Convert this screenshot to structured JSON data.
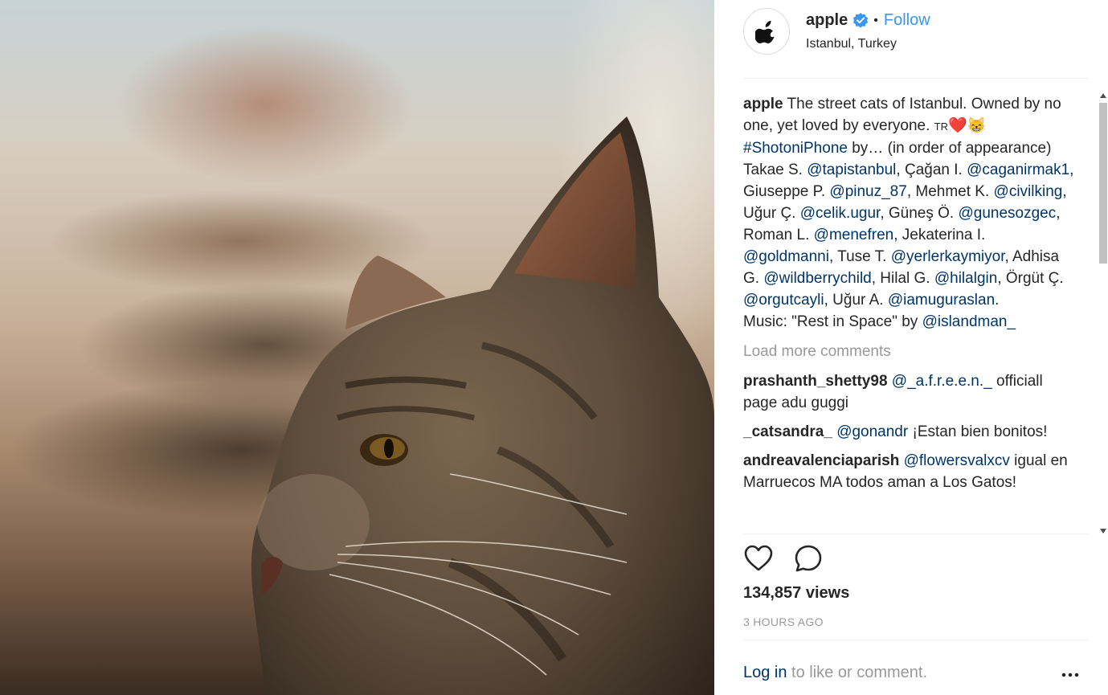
{
  "post": {
    "username": "apple",
    "separator": "•",
    "follow_label": "Follow",
    "location": "Istanbul, Turkey"
  },
  "caption": {
    "username": "apple",
    "t1": " The street cats of Istanbul. Owned by no one, yet loved by everyone. ",
    "flag": "TR",
    "emoji": "❤️😸",
    "hashtag": "#ShotoniPhone",
    "t2": " by… (in order of appearance) Takae S. ",
    "m1": "@tapistanbul",
    "t3": ", Çağan I. ",
    "m2": "@caganirmak1",
    "t4": ", Giuseppe P. ",
    "m3": "@pinuz_87",
    "t5": ", Mehmet K. ",
    "m4": "@civilking",
    "t6": ", Uğur Ç. ",
    "m5": "@celik.ugur",
    "t7": ", Güneş Ö. ",
    "m6": "@gunesozgec",
    "t8": ", Roman L. ",
    "m7": "@menefren",
    "t9": ", Jekaterina I. ",
    "m8": "@goldmanni",
    "t10": ", Tuse T. ",
    "m9": "@yerlerkaymiyor",
    "t11": ", Adhisa G. ",
    "m10": "@wildberrychild",
    "t12": ", Hilal G. ",
    "m11": "@hilalgin",
    "t13": ", Örgüt Ç. ",
    "m12": "@orgutcayli",
    "t14": ", Uğur A. ",
    "m13": "@iamuguraslan",
    "t15": ".",
    "music": "Music: \"Rest in Space\" by ",
    "m14": "@islandman_"
  },
  "load_more": "Load more comments",
  "comments": [
    {
      "user": "prashanth_shetty98",
      "mention": "@_a.f.r.e.e.n._",
      "text": " officiall page adu guggi"
    },
    {
      "user": "_catsandra_",
      "mention": "@gonandr",
      "text": " ¡Estan bien bonitos!"
    },
    {
      "user": "andreavalenciaparish",
      "mention": "@flowersvalxcv",
      "text": " igual en Marruecos MA todos aman a Los Gatos!"
    }
  ],
  "views": "134,857 views",
  "timestamp": "3 HOURS AGO",
  "login": {
    "link": "Log in",
    "text": " to like or comment."
  },
  "icons": [
    "apple-logo-icon",
    "verified-badge-icon",
    "heart-icon",
    "comment-icon",
    "more-options-icon"
  ],
  "colors": {
    "link": "#003569",
    "follow": "#3897f0",
    "muted": "#999999",
    "verified": "#3897f0"
  }
}
